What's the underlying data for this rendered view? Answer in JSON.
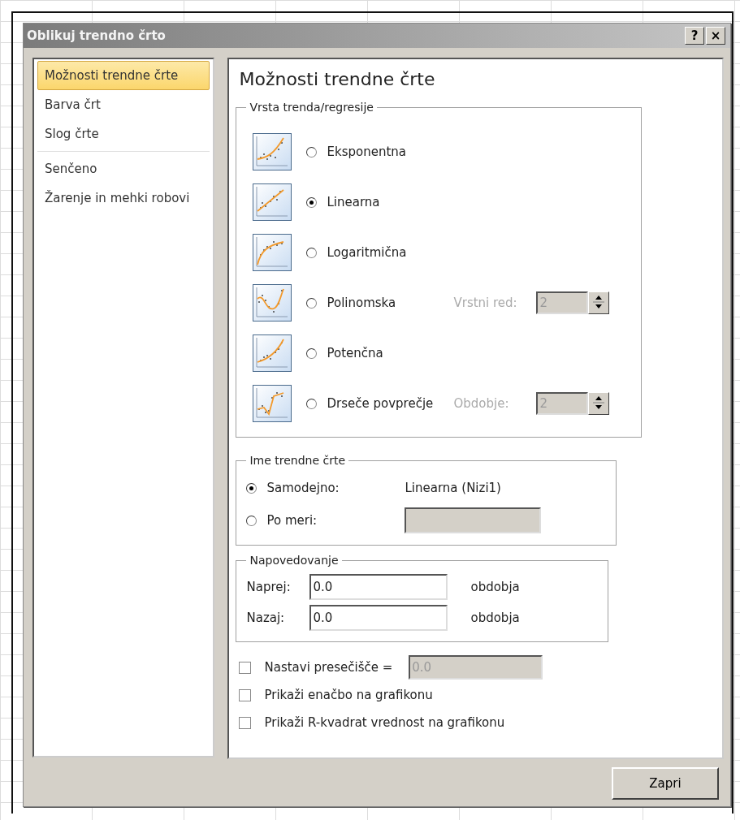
{
  "window": {
    "title": "Oblikuj trendno črto",
    "buttons": [
      "?",
      "×"
    ]
  },
  "sidebar": {
    "items": [
      {
        "label": "Možnosti trendne črte",
        "selected": true
      },
      {
        "label": "Barva črt",
        "selected": false
      },
      {
        "label": "Slog črte",
        "selected": false
      },
      {
        "label": "Senčeno",
        "selected": false
      },
      {
        "label": "Žarenje in mehki robovi",
        "selected": false
      }
    ]
  },
  "panel": {
    "title": "Možnosti trendne črte",
    "trend_type": {
      "title": "Vrsta trenda/regresije",
      "options": [
        {
          "kind": "exponential",
          "label": "Eksponentna",
          "selected": false
        },
        {
          "kind": "linear",
          "label": "Linearna",
          "selected": true
        },
        {
          "kind": "logarithmic",
          "label": "Logaritmična",
          "selected": false
        },
        {
          "kind": "polynomial",
          "label": "Polinomska",
          "selected": false,
          "parameter": {
            "label": "Vrstni red:",
            "value": "2",
            "disabled": true
          }
        },
        {
          "kind": "power",
          "label": "Potenčna",
          "selected": false
        },
        {
          "kind": "moving-average",
          "label": "Drseče povprečje",
          "selected": false,
          "parameter": {
            "label": "Obdobje:",
            "value": "2",
            "disabled": true
          }
        }
      ]
    },
    "trend_name": {
      "title": "Ime trendne črte",
      "options": [
        {
          "kind": "text",
          "label": "Samodejno:",
          "selected": true,
          "value": "Linearna (Nizi1)"
        },
        {
          "kind": "field",
          "label": "Po meri:",
          "selected": false,
          "disabled": true
        }
      ]
    },
    "forecast": {
      "title": "Napovedovanje",
      "rows": [
        {
          "label": "Naprej:",
          "value": "0.0",
          "unit": "obdobja"
        },
        {
          "label": "Nazaj:",
          "value": "0.0",
          "unit": "obdobja"
        }
      ]
    },
    "checkboxes": [
      {
        "label": "Nastavi presečišče =",
        "checked": false,
        "field": {
          "value": "0.0",
          "disabled": true
        }
      },
      {
        "label": "Prikaži enačbo na grafikonu",
        "checked": false
      },
      {
        "label": "Prikaži R-kvadrat vrednost na grafikonu",
        "checked": false
      }
    ]
  },
  "buttons": [
    "Zapri"
  ]
}
